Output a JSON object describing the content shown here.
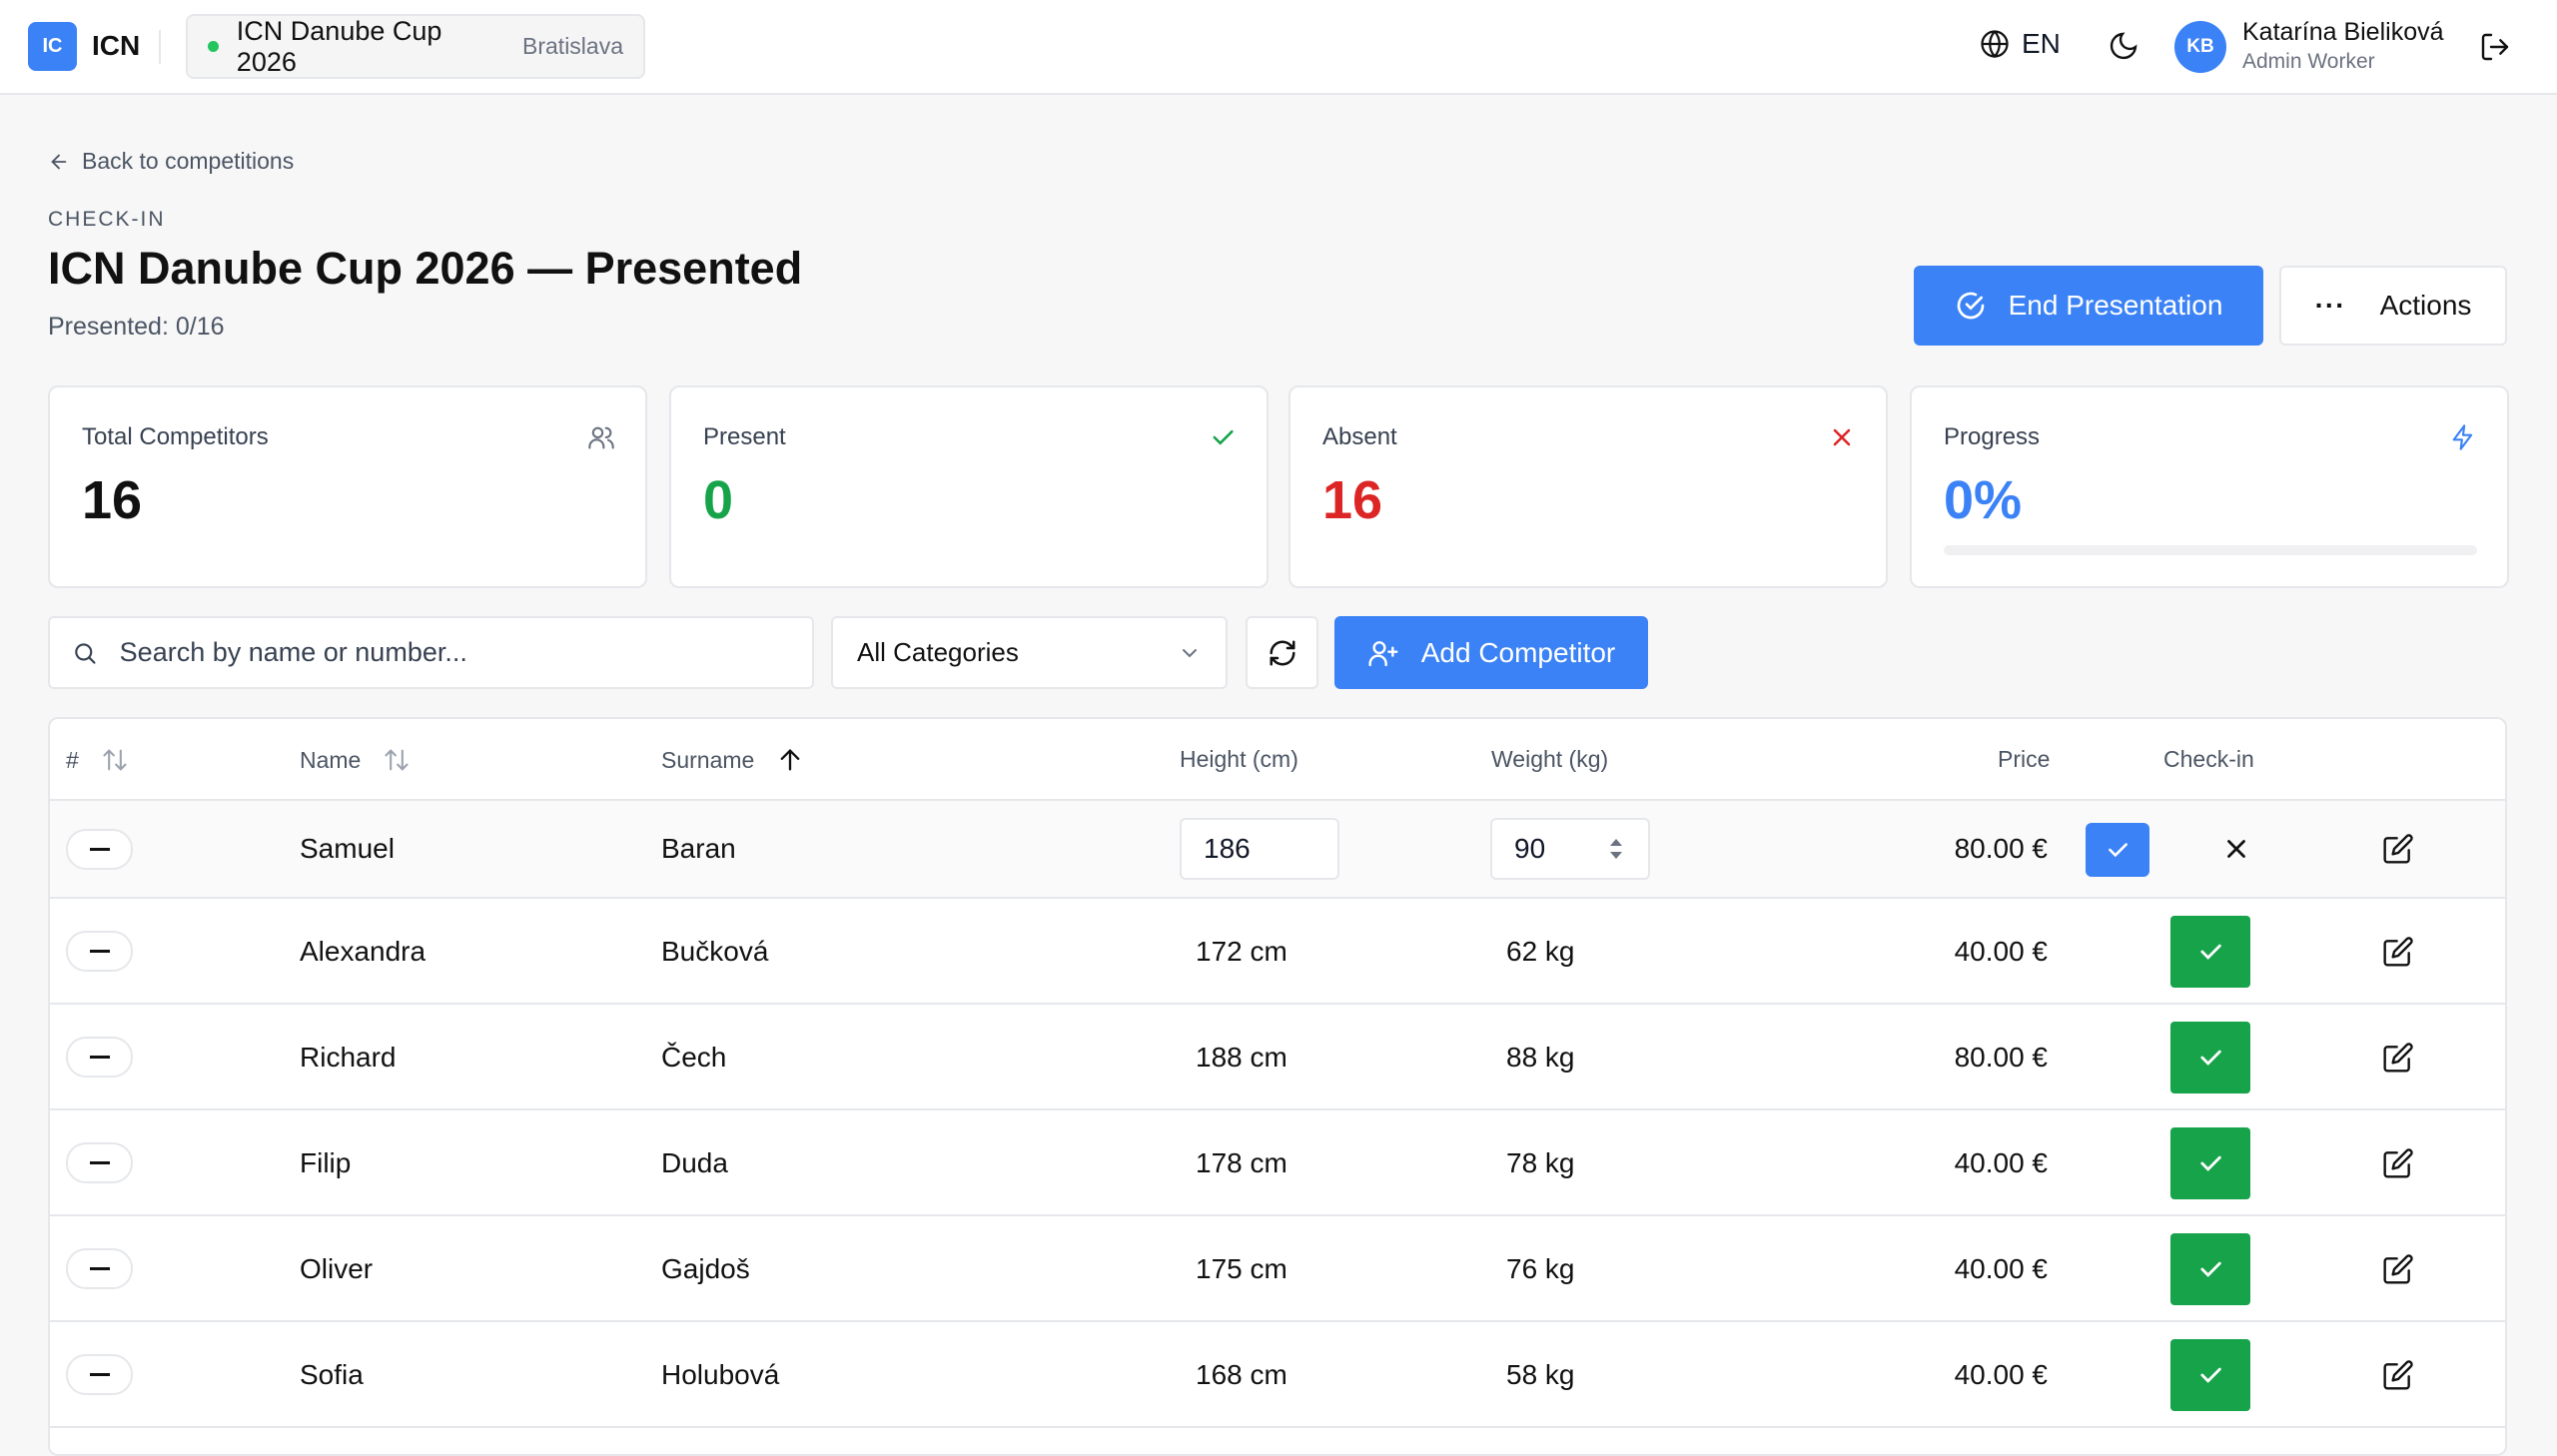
{
  "app": {
    "logo_initials": "IC",
    "logo_text": "ICN"
  },
  "competition": {
    "name": "ICN Danube Cup 2026",
    "city": "Bratislava"
  },
  "header": {
    "language": "EN"
  },
  "user": {
    "initials": "KB",
    "name": "Katarína Bieliková",
    "role": "Admin Worker"
  },
  "page": {
    "back_label": "Back to competitions",
    "section_label": "CHECK-IN",
    "title": "ICN Danube Cup 2026 — Presented",
    "subtitle": "Presented: 0/16",
    "end_button": "End Presentation",
    "actions_button": "Actions",
    "actions_dots": "···"
  },
  "stats": {
    "total": {
      "label": "Total Competitors",
      "value": "16"
    },
    "present": {
      "label": "Present",
      "value": "0"
    },
    "absent": {
      "label": "Absent",
      "value": "16"
    },
    "progress": {
      "label": "Progress",
      "value": "0%",
      "fraction": 0
    }
  },
  "toolbar": {
    "search_placeholder": "Search by name or number...",
    "category": "All Categories",
    "add_button": "Add Competitor"
  },
  "table": {
    "columns": {
      "num": "#",
      "name": "Name",
      "surname": "Surname",
      "height": "Height (cm)",
      "weight": "Weight (kg)",
      "price": "Price",
      "checkin": "Check-in"
    },
    "editing_row": {
      "name": "Samuel",
      "surname": "Baran",
      "height": "186",
      "weight": "90",
      "price": "80.00 €"
    },
    "rows": [
      {
        "name": "Alexandra",
        "surname": "Bučková",
        "height": "172 cm",
        "weight": "62 kg",
        "price": "40.00 €"
      },
      {
        "name": "Richard",
        "surname": "Čech",
        "height": "188 cm",
        "weight": "88 kg",
        "price": "80.00 €"
      },
      {
        "name": "Filip",
        "surname": "Duda",
        "height": "178 cm",
        "weight": "78 kg",
        "price": "40.00 €"
      },
      {
        "name": "Oliver",
        "surname": "Gajdoš",
        "height": "175 cm",
        "weight": "76 kg",
        "price": "40.00 €"
      },
      {
        "name": "Sofia",
        "surname": "Holubová",
        "height": "168 cm",
        "weight": "58 kg",
        "price": "40.00 €"
      }
    ]
  },
  "colors": {
    "accent": "#3b82f6",
    "success": "#16a34a",
    "danger": "#dc2626"
  }
}
